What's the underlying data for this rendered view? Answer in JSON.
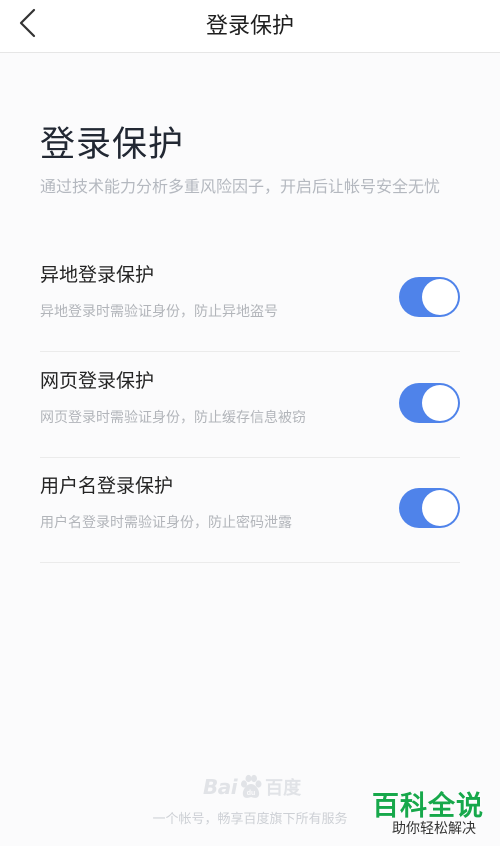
{
  "nav": {
    "title": "登录保护"
  },
  "header": {
    "title": "登录保护",
    "description": "通过技术能力分析多重风险因子，开启后让帐号安全无忧"
  },
  "settings": [
    {
      "title": "异地登录保护",
      "subtitle": "异地登录时需验证身份，防止异地盗号",
      "enabled": true
    },
    {
      "title": "网页登录保护",
      "subtitle": "网页登录时需验证身份，防止缓存信息被窃",
      "enabled": true
    },
    {
      "title": "用户名登录保护",
      "subtitle": "用户名登录时需验证身份，防止密码泄露",
      "enabled": true
    }
  ],
  "footer": {
    "logo_latin": "Bai",
    "logo_du": "du",
    "logo_cn": "百度",
    "slogan": "一个帐号，畅享百度旗下所有服务"
  },
  "watermark": {
    "title": "百科全说",
    "subtitle": "助你轻松解决"
  },
  "colors": {
    "accent": "#4f83ea",
    "background": "#fbfbfc",
    "watermark_green": "#17a84b"
  },
  "icons": {
    "back": "chevron-left-icon",
    "logo": "baidu-paw-icon"
  }
}
